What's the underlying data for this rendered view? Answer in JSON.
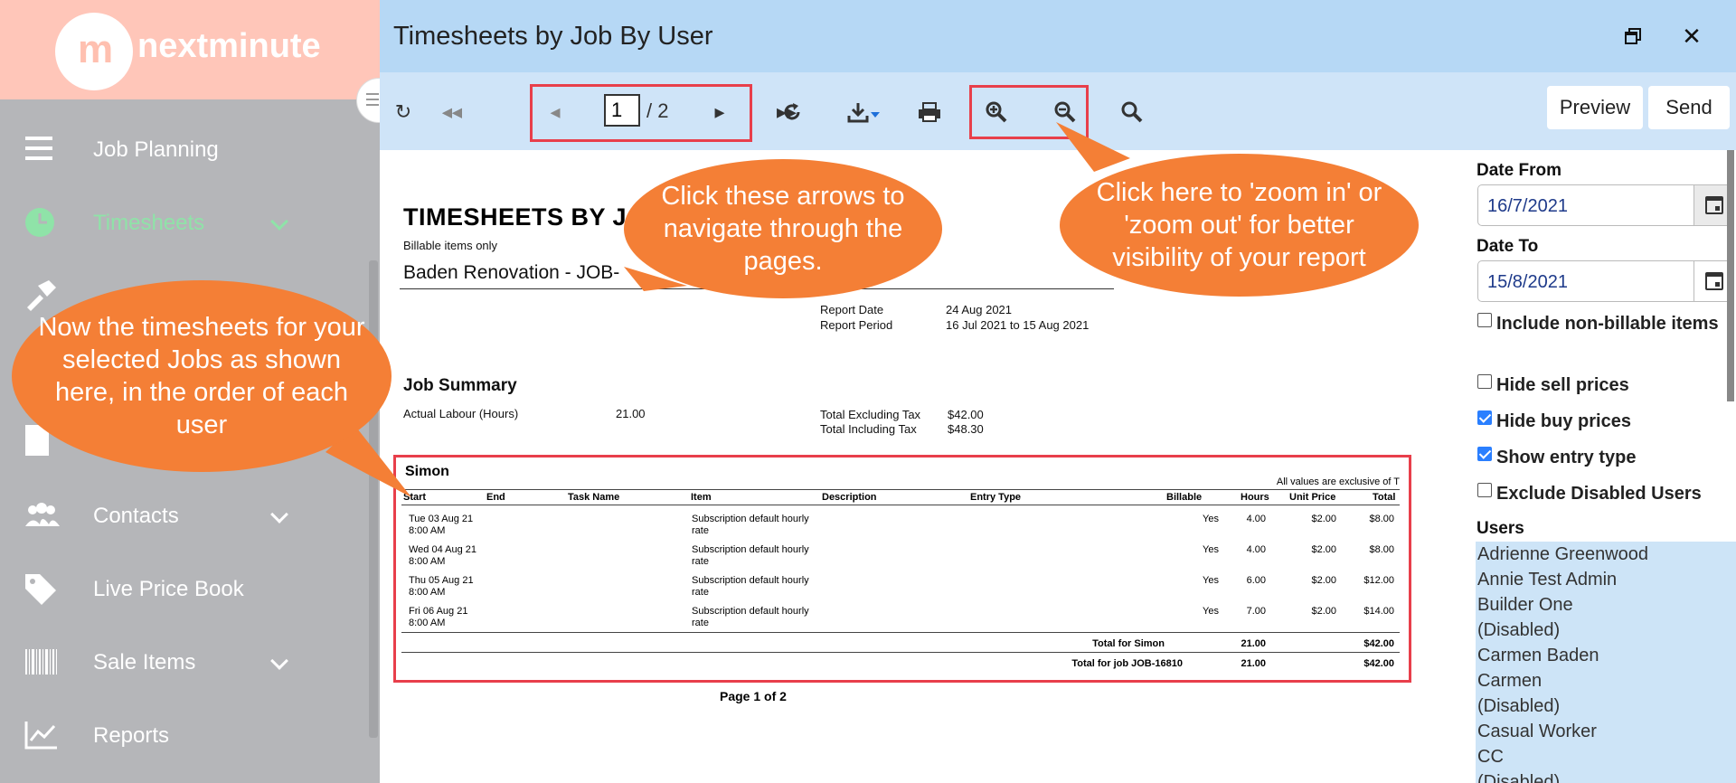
{
  "app": {
    "logo_mark": "m",
    "logo_text": "nextminute"
  },
  "sidebar": {
    "items": [
      {
        "label": "Job Planning",
        "icon": "hamburger-icon"
      },
      {
        "label": "Timesheets",
        "icon": "clock-icon",
        "active": true,
        "chevron": true
      },
      {
        "label": "Contacts",
        "icon": "contacts-icon",
        "chevron": true
      },
      {
        "label": "Live Price Book",
        "icon": "tag-icon"
      },
      {
        "label": "Sale Items",
        "icon": "barcode-icon",
        "chevron": true
      },
      {
        "label": "Reports",
        "icon": "chart-icon"
      }
    ]
  },
  "window": {
    "title": "Timesheets by Job By User"
  },
  "toolbar": {
    "page_current": "1",
    "page_total": "/ 2",
    "preview_label": "Preview",
    "send_label": "Send"
  },
  "report": {
    "title": "TIMESHEETS BY J",
    "subtitle": "Billable items only",
    "job": "Baden Renovation - JOB-",
    "report_date_label": "Report Date",
    "report_date": "24 Aug 2021",
    "report_period_label": "Report Period",
    "report_period": "16 Jul 2021 to 15 Aug 2021",
    "job_summary_heading": "Job Summary",
    "actual_labour_label": "Actual Labour (Hours)",
    "actual_labour_value": "21.00",
    "total_excl_label": "Total Excluding Tax",
    "total_excl_value": "$42.00",
    "total_incl_label": "Total Including Tax",
    "total_incl_value": "$48.30",
    "user_name": "Simon",
    "exclusive_note": "All values are exclusive of T",
    "columns": [
      "Start",
      "End",
      "Task Name",
      "Item",
      "Description",
      "Entry Type",
      "Billable",
      "Hours",
      "Unit Price",
      "Total"
    ],
    "rows": [
      {
        "start1": "Tue 03 Aug 21",
        "start2": "8:00 AM",
        "item1": "Subscription default hourly",
        "item2": "rate",
        "billable": "Yes",
        "hours": "4.00",
        "unit": "$2.00",
        "total": "$8.00"
      },
      {
        "start1": "Wed 04 Aug 21",
        "start2": "8:00 AM",
        "item1": "Subscription default hourly",
        "item2": "rate",
        "billable": "Yes",
        "hours": "4.00",
        "unit": "$2.00",
        "total": "$8.00"
      },
      {
        "start1": "Thu 05 Aug 21",
        "start2": "8:00 AM",
        "item1": "Subscription default hourly",
        "item2": "rate",
        "billable": "Yes",
        "hours": "6.00",
        "unit": "$2.00",
        "total": "$12.00"
      },
      {
        "start1": "Fri 06 Aug 21",
        "start2": "8:00 AM",
        "item1": "Subscription default hourly",
        "item2": "rate",
        "billable": "Yes",
        "hours": "7.00",
        "unit": "$2.00",
        "total": "$14.00"
      }
    ],
    "total_user_label": "Total for Simon",
    "total_user_hours": "21.00",
    "total_user_amount": "$42.00",
    "total_job_label": "Total for job JOB-16810",
    "total_job_hours": "21.00",
    "total_job_amount": "$42.00",
    "page_of": "Page 1 of 2"
  },
  "filters": {
    "date_from_label": "Date From",
    "date_from": "16/7/2021",
    "date_to_label": "Date To",
    "date_to": "15/8/2021",
    "include_non_billable": "Include non-billable items",
    "hide_sell": "Hide sell prices",
    "hide_buy": "Hide buy prices",
    "show_entry_type": "Show entry type",
    "exclude_disabled": "Exclude Disabled Users",
    "users_label": "Users",
    "users": [
      "Adrienne Greenwood",
      "Annie Test Admin",
      "Builder One",
      "(Disabled)",
      "Carmen Baden",
      "Carmen",
      "(Disabled)",
      "Casual Worker",
      "CC",
      "(Disabled)"
    ]
  },
  "callouts": {
    "arrows": "Click these arrows to navigate through the pages.",
    "zoom": "Click here to 'zoom in' or 'zoom out' for better visibility of your report",
    "timesheets": "Now the timesheets for your selected Jobs as shown here, in the order of each user"
  },
  "colors": {
    "accent": "#f47f36",
    "highlight": "#e83f4b",
    "titlebar": "#b6d8f5",
    "toolbar": "#cfe4f8",
    "sidebar": "#b5b6b9",
    "logo_bg": "#ffc6b9",
    "active": "#8fe3a8"
  }
}
